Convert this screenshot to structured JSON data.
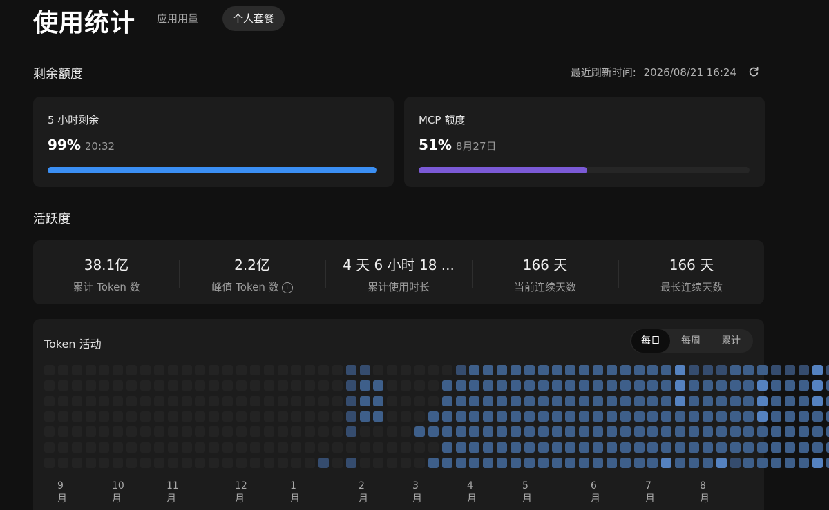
{
  "header": {
    "title": "使用统计",
    "tabs": [
      {
        "label": "应用用量",
        "active": false
      },
      {
        "label": "个人套餐",
        "active": true
      }
    ]
  },
  "quota": {
    "section_title": "剩余额度",
    "refresh_label": "最近刷新时间:",
    "refresh_time": "2026/08/21 16:24",
    "refresh_icon": "refresh-icon",
    "cards": [
      {
        "label": "5 小时剩余",
        "percent_text": "99%",
        "sub": "20:32",
        "fill_fraction": 1.0,
        "color": "#3b8ff3"
      },
      {
        "label": "MCP 额度",
        "percent_text": "51%",
        "sub": "8月27日",
        "fill_fraction": 0.51,
        "color": "#7b5ad6"
      }
    ]
  },
  "activity": {
    "section_title": "活跃度",
    "stats": [
      {
        "value": "38.1亿",
        "label": "累计 Token 数"
      },
      {
        "value": "2.2亿",
        "label": "峰值 Token 数",
        "info_icon": true
      },
      {
        "value": "4 天 6 小时 18 ...",
        "label": "累计使用时长"
      },
      {
        "value": "166 天",
        "label": "当前连续天数"
      },
      {
        "value": "166 天",
        "label": "最长连续天数"
      }
    ],
    "token_activity": {
      "title": "Token 活动",
      "views": [
        {
          "label": "每日",
          "active": true
        },
        {
          "label": "每周",
          "active": false
        },
        {
          "label": "累计",
          "active": false
        }
      ],
      "months": [
        "9月",
        "10月",
        "11月",
        "12月",
        "1月",
        "2月",
        "3月",
        "4月",
        "5月",
        "6月",
        "7月",
        "8月"
      ],
      "level_colors": [
        "#232323",
        "#2c3a50",
        "#354c6e",
        "#3e5f8a",
        "#5582c0",
        "#92bde9"
      ],
      "heatmap_rows": [
        "000000000000000000000022000000233333333333333342223332224223",
        "000000000000000000000023300003333333333333333343333343334333",
        "000000000000000000000023300003333333333333333343333343334334",
        "000000000000000000000023300033333333333333333333333343333343",
        "000000000000000000000020000333333333333333333333333333333335",
        "000000000000000000000000000003333333333333333333333333333333",
        "000000000000000000002020000033333333333333333433342333334340"
      ]
    }
  }
}
